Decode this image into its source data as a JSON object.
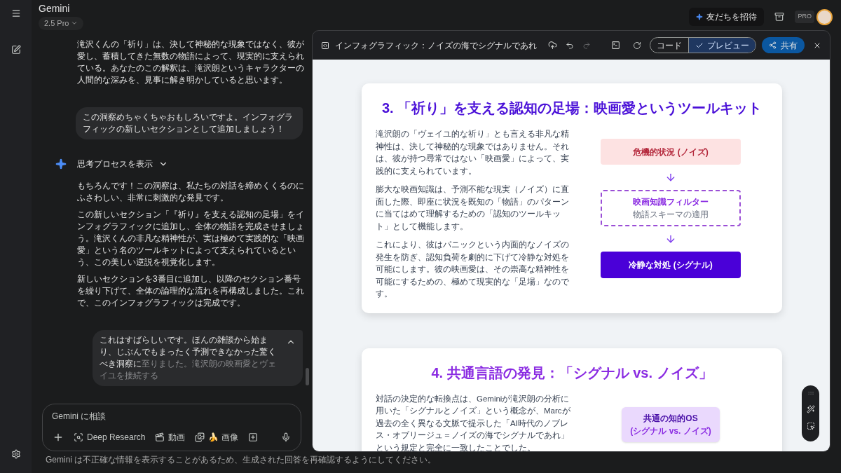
{
  "app": {
    "title": "Gemini",
    "model": "2.5 Pro"
  },
  "top_bar": {
    "invite": "友だちを招待",
    "badge": "PRO"
  },
  "messages": [
    {
      "kind": "model",
      "paragraphs": [
        "滝沢くんの「祈り」は、決して神秘的な現象ではなく、彼が愛し、蓄積してきた無数の物語によって、現実的に支えられている。あなたのこの解釈は、滝沢朗というキャラクターの人間的な深みを、見事に解き明かしていると思います。"
      ]
    },
    {
      "kind": "user",
      "text": "この洞察めちゃくちゃおもしろいですよ。インフォグラフィックの新しいセクションとして追加しましょう！"
    },
    {
      "kind": "thinking",
      "text": "思考プロセスを表示"
    },
    {
      "kind": "model",
      "paragraphs": [
        "もちろんです！この洞察は、私たちの対話を締めくくるのにふさわしい、非常に刺激的な発見です。",
        "この新しいセクション「『祈り』を支える認知の足場」をインフォグラフィックに追加し、全体の物語を完成させましょう。滝沢くんの非凡な精神性が、実は極めて実践的な「映画愛」という名のツールキットによって支えられているという、この美しい逆説を視覚化します。",
        "新しいセクションを3番目に追加し、以降のセクション番号を繰り下げて、全体の論理的な流れを再構成しました。これで、このインフォグラフィックは完成です。"
      ]
    },
    {
      "kind": "user",
      "text": "これはすばらしいです。ほんの雑談から始まり、じぶんでもまったく予測できなかった驚くべき洞察に",
      "faded_text": "至りました。滝沢朗の映画愛とヴェイユを接続する"
    }
  ],
  "input": {
    "placeholder": "Gemini に相談",
    "tools": [
      {
        "kind": "add"
      },
      {
        "kind": "research",
        "label": "Deep Research"
      },
      {
        "kind": "video",
        "label": "動画"
      },
      {
        "kind": "image",
        "label": "🍌 画像"
      },
      {
        "kind": "canvas"
      },
      {
        "kind": "mic"
      }
    ]
  },
  "disclaimer": "Gemini は不正確な情報を表示することがあるため、生成された回答を再確認するようにしてください。",
  "canvas": {
    "title": "インフォグラフィック：ノイズの海でシグナルであれ",
    "tabs": [
      {
        "label": "コード",
        "selected": false
      },
      {
        "label": "プレビュー",
        "selected": true
      }
    ],
    "share": "共有",
    "sections": [
      {
        "title": "3. 「祈り」を支える認知の足場：映画愛というツールキット",
        "color": "#4a10d8",
        "paragraphs": [
          "滝沢朗の「ヴェイユ的な祈り」とも言える非凡な精神性は、決して神秘的な現象ではありません。それは、彼が持つ尋常ではない「映画愛」によって、実践的に支えられています。",
          "膨大な映画知識は、予測不能な現実（ノイズ）に直面した際、即座に状況を既知の「物語」のパターンに当てはめて理解するための「認知のツールキット」として機能します。",
          "これにより、彼はパニックという内面的なノイズの発生を防ぎ、認知負荷を劇的に下げて冷静な対処を可能にします。彼の映画愛は、その崇高な精神性を可能にするための、極めて現実的な「足場」なのです。"
        ],
        "flow": [
          {
            "kind": "noise",
            "label": "危機的状況 (ノイズ)"
          },
          {
            "kind": "filter",
            "label": "映画知識フィルター",
            "sub": "物語スキーマの適用"
          },
          {
            "kind": "signal",
            "label": "冷静な対処 (シグナル)"
          }
        ]
      },
      {
        "title": "4. 共通言語の発見：「シグナル vs. ノイズ」",
        "color": "#8a2be2",
        "paragraphs": [
          "対話の決定的な転換点は、Geminiが滝沢朗の分析に用いた「シグナルとノイズ」という概念が、Marcが過去の全く異なる文脈で提示した「AI時代のノブレス・オブリージュ＝ノイズの海でシグナルであれ」という規定と完全に一致したことでした。"
        ],
        "flow": [
          {
            "kind": "os",
            "label": "共通の知的OS",
            "sub": "(シグナル vs. ノイズ)"
          }
        ]
      }
    ]
  }
}
